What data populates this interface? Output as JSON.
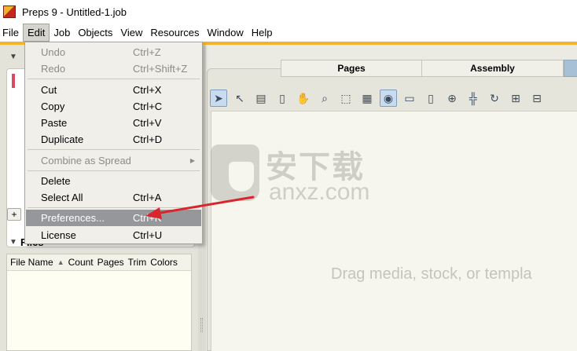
{
  "titlebar": {
    "title": "Preps 9 - Untitled-1.job"
  },
  "menubar": [
    "File",
    "Edit",
    "Job",
    "Objects",
    "View",
    "Resources",
    "Window",
    "Help"
  ],
  "edit_menu": {
    "undo": {
      "label": "Undo",
      "shortcut": "Ctrl+Z"
    },
    "redo": {
      "label": "Redo",
      "shortcut": "Ctrl+Shift+Z"
    },
    "cut": {
      "label": "Cut",
      "shortcut": "Ctrl+X"
    },
    "copy": {
      "label": "Copy",
      "shortcut": "Ctrl+C"
    },
    "paste": {
      "label": "Paste",
      "shortcut": "Ctrl+V"
    },
    "duplicate": {
      "label": "Duplicate",
      "shortcut": "Ctrl+D"
    },
    "combine": {
      "label": "Combine as Spread"
    },
    "delete": {
      "label": "Delete"
    },
    "select_all": {
      "label": "Select All",
      "shortcut": "Ctrl+A"
    },
    "preferences": {
      "label": "Preferences...",
      "shortcut": "Ctrl+K"
    },
    "license": {
      "label": "License",
      "shortcut": "Ctrl+U"
    }
  },
  "tabs": [
    "Pages",
    "Assembly"
  ],
  "left_panel": {
    "add_button": "+",
    "files_header": "Files",
    "columns": [
      "File Name",
      "Count",
      "Pages",
      "Trim",
      "Colors"
    ]
  },
  "canvas": {
    "hint": "Drag media, stock, or templa"
  },
  "watermark": {
    "cn": "安下载",
    "en": "anxz.com"
  },
  "colors": {
    "accent_bar": "#f4b32a",
    "highlight": "#96979b",
    "arrow": "#d9262c"
  }
}
